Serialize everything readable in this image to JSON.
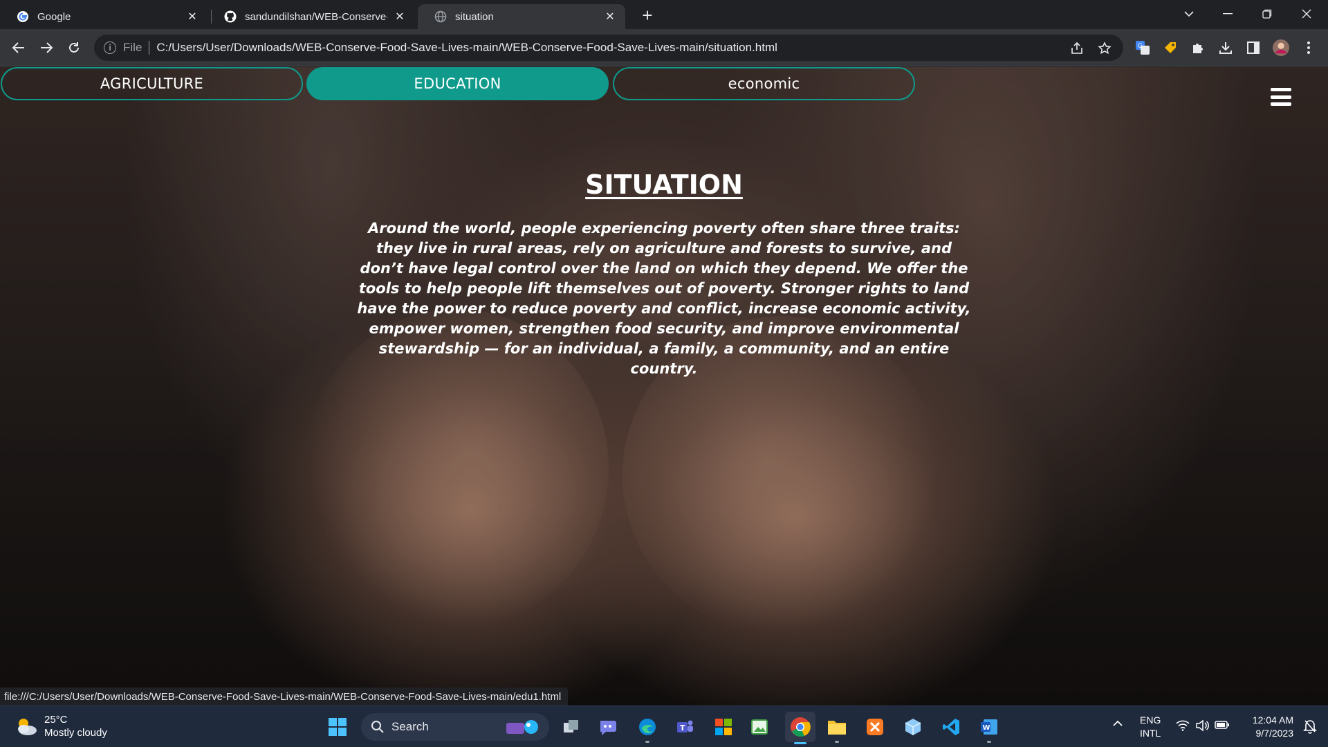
{
  "browser": {
    "tabs": [
      {
        "title": "Google",
        "icon": "google-g-icon",
        "active": false
      },
      {
        "title": "sandundilshan/WEB-Conserve-Fo",
        "icon": "github-icon",
        "active": false
      },
      {
        "title": "situation",
        "icon": "globe-icon",
        "active": true
      }
    ],
    "close_glyph": "✕",
    "new_tab_glyph": "+",
    "file_label": "File",
    "url": "C:/Users/User/Downloads/WEB-Conserve-Food-Save-Lives-main/WEB-Conserve-Food-Save-Lives-main/situation.html",
    "status_link": "file:///C:/Users/User/Downloads/WEB-Conserve-Food-Save-Lives-main/WEB-Conserve-Food-Save-Lives-main/edu1.html"
  },
  "page": {
    "nav": [
      {
        "label": "AGRICULTURE",
        "active": false
      },
      {
        "label": "EDUCATION",
        "active": true
      },
      {
        "label": "economic",
        "active": false
      }
    ],
    "title": "SITUATION",
    "lines": [
      "Around the world, people experiencing poverty often share three traits:",
      "they live in rural areas, rely on agriculture and forests to survive, and",
      "don’t have legal control over the land on which they depend. We offer the",
      "tools to help people lift themselves out of poverty. Stronger rights to land",
      "have the power to reduce poverty and conflict, increase economic activity,",
      "empower women, strengthen food security, and improve environmental",
      "stewardship — for an individual, a family, a community, and an entire country."
    ],
    "accent_color": "#0f9a8c"
  },
  "taskbar": {
    "weather_temp": "25°C",
    "weather_desc": "Mostly cloudy",
    "search_label": "Search",
    "lang_line1": "ENG",
    "lang_line2": "INTL",
    "time": "12:04 AM",
    "date": "9/7/2023"
  }
}
